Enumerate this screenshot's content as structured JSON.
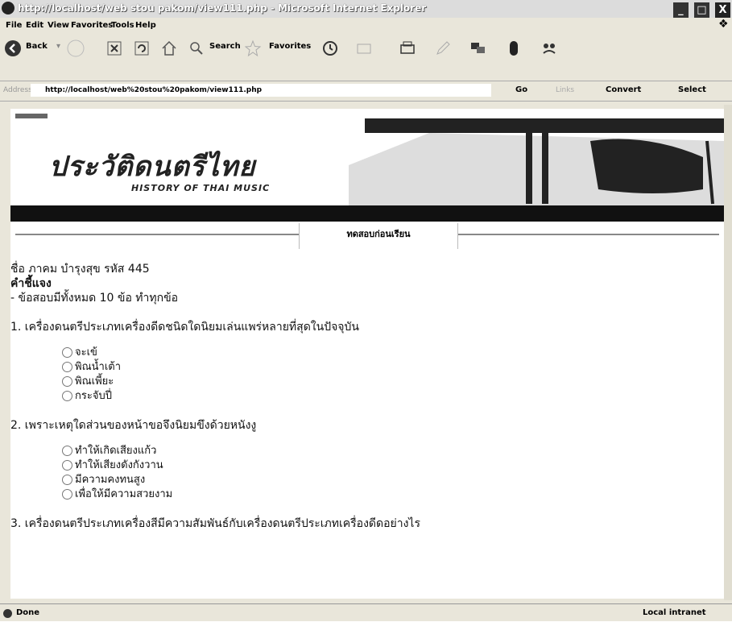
{
  "window": {
    "title": "http://localhost/web stou pakom/view111.php - Microsoft Internet Explorer",
    "controls": [
      "_",
      "□",
      "X"
    ]
  },
  "menu": [
    "File",
    "Edit",
    "View",
    "Favorites",
    "Tools",
    "Help"
  ],
  "toolbar": {
    "back": "Back",
    "search": "Search",
    "favorites": "Favorites"
  },
  "address": {
    "label": "Address",
    "url": "http://localhost/web%20stou%20pakom/view111.php",
    "go": "Go",
    "links": "Links",
    "convert": "Convert",
    "select": "Select"
  },
  "page": {
    "logo_thai": "ประวัติดนตรีไทย",
    "logo_en": "HISTORY OF THAI MUSIC",
    "tab_label": "ทดสอบก่อนเรียน",
    "student_line": "ชื่อ ภาคม บำรุงสุข รหัส 445",
    "instruction_title": "คำชี้แจง",
    "instruction_text": "- ข้อสอบมีทั้งหมด 10 ข้อ ทำทุกข้อ",
    "questions": [
      {
        "text": "1. เครื่องดนตรีประเภทเครื่องดีดชนิดใดนิยมเล่นแพร่หลายที่สุดในปัจจุบัน",
        "options": [
          "จะเข้",
          "พิณน้ำเต้า",
          "พิณเพี้ยะ",
          "กระจับปี่"
        ]
      },
      {
        "text": "2. เพราะเหตุใดส่วนของหน้าขอจึงนิยมขึงด้วยหนังงู",
        "options": [
          "ทำให้เกิดเสียงแก้ว",
          "ทำให้เสียงดังกังวาน",
          "มีความคงทนสูง",
          "เพื่อให้มีความสวยงาม"
        ]
      },
      {
        "text": "3. เครื่องดนตรีประเภทเครื่องสีมีความสัมพันธ์กับเครื่องดนตรีประเภทเครื่องดีดอย่างไร",
        "options": []
      }
    ]
  },
  "status": {
    "left": "Done",
    "right": "Local intranet"
  }
}
